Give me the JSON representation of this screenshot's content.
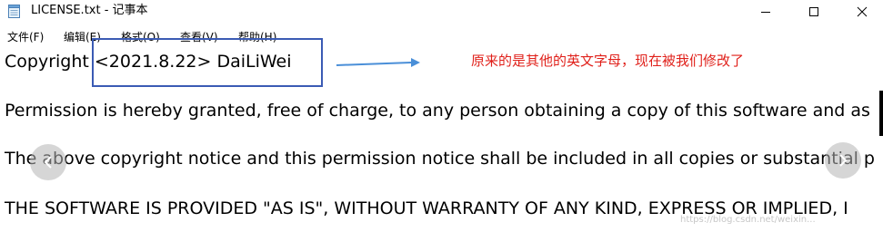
{
  "window": {
    "title": "LICENSE.txt - 记事本",
    "icons": {
      "app": "notepad-icon",
      "minimize": "minimize-icon",
      "maximize": "maximize-icon",
      "close": "close-icon"
    }
  },
  "menu": {
    "items": [
      {
        "label": "文件(F)"
      },
      {
        "label": "编辑(E)"
      },
      {
        "label": "格式(O)"
      },
      {
        "label": "查看(V)"
      },
      {
        "label": "帮助(H)"
      }
    ]
  },
  "document": {
    "lines": [
      "Copyright <2021.8.22> DaiLiWei",
      "Permission is hereby granted, free of charge, to any person obtaining a copy of this software and as",
      "The above copyright notice and this permission notice shall be included in all copies or substantial p",
      "THE SOFTWARE IS PROVIDED \"AS IS\", WITHOUT WARRANTY OF ANY KIND, EXPRESS OR IMPLIED, I"
    ]
  },
  "annotation": {
    "text": "原来的是其他的英文字母，现在被我们修改了",
    "color": "#e0201a",
    "box_color": "#3b5bb4",
    "arrow_color": "#4a8fd8"
  },
  "overlay": {
    "prev_icon": "chevron-left-icon",
    "next_icon": "chevron-right-icon"
  },
  "watermark": "https://blog.csdn.net/weixin..."
}
